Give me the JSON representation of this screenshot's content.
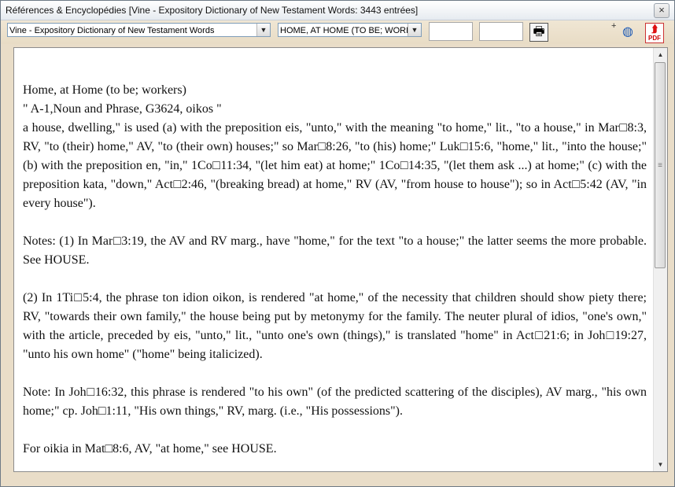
{
  "window": {
    "title": "Références & Encyclopédies [Vine - Expository Dictionary of New Testament Words:  3443 entrées]",
    "close_glyph": "×"
  },
  "toolbar": {
    "dictionary_select": "Vine - Expository Dictionary of New Testament Words",
    "entry_select": "HOME, AT HOME (TO BE; WORK",
    "arrow_glyph": "▼",
    "print_glyph": "🖶",
    "plus_glyph": "+",
    "globe_glyph": "◍",
    "pdf_glyph": "⮭",
    "pdf_label": "PDF"
  },
  "article": {
    "heading": "Home, at Home (to be; workers)",
    "subheading": "\" A-1,Noun and Phrase, G3624, oikos \"",
    "p1": "a house, dwelling,\" is used (a) with the preposition eis, \"unto,\" with the meaning \"to home,\" lit., \"to a house,\" in Mar□8:3, RV, \"to (their) home,\" AV, \"to (their own) houses;\" so Mar□8:26, \"to (his) home;\" Luk□15:6, \"home,\" lit., \"into the house;\" (b) with the preposition en, \"in,\" 1Co□11:34, \"(let him eat) at home;\" 1Co□14:35, \"(let them ask ...) at home;\" (c) with the preposition kata, \"down,\" Act□2:46, \"(breaking bread) at home,\" RV (AV, \"from house to house\"); so in Act□5:42 (AV, \"in every house\").",
    "p2": "Notes: (1) In Mar□3:19, the AV and RV marg., have \"home,\" for the text \"to a house;\" the latter seems the more probable. See HOUSE.",
    "p3": "(2) In 1Ti□5:4, the phrase ton idion oikon, is rendered \"at home,\" of the necessity that children should show piety there; RV, \"towards their own family,\" the house being put by metonymy for the family. The neuter plural of idios, \"one's own,\" with the article, preceded by eis, \"unto,\" lit., \"unto one's own (things),\" is translated \"home\" in Act□21:6; in Joh□19:27, \"unto his own home\" (\"home\" being italicized).",
    "p4": "Note: In Joh□16:32, this phrase is rendered \"to his own\" (of the predicted scattering of the disciples), AV marg., \"his own home;\" cp. Joh□1:11, \"His own things,\" RV, marg. (i.e., \"His possessions\").",
    "p5": "For oikia in Mat□8:6, AV, \"at home,\" see HOUSE."
  },
  "scrollbar": {
    "up_glyph": "▲",
    "down_glyph": "▼",
    "grip_glyph": "≡"
  }
}
